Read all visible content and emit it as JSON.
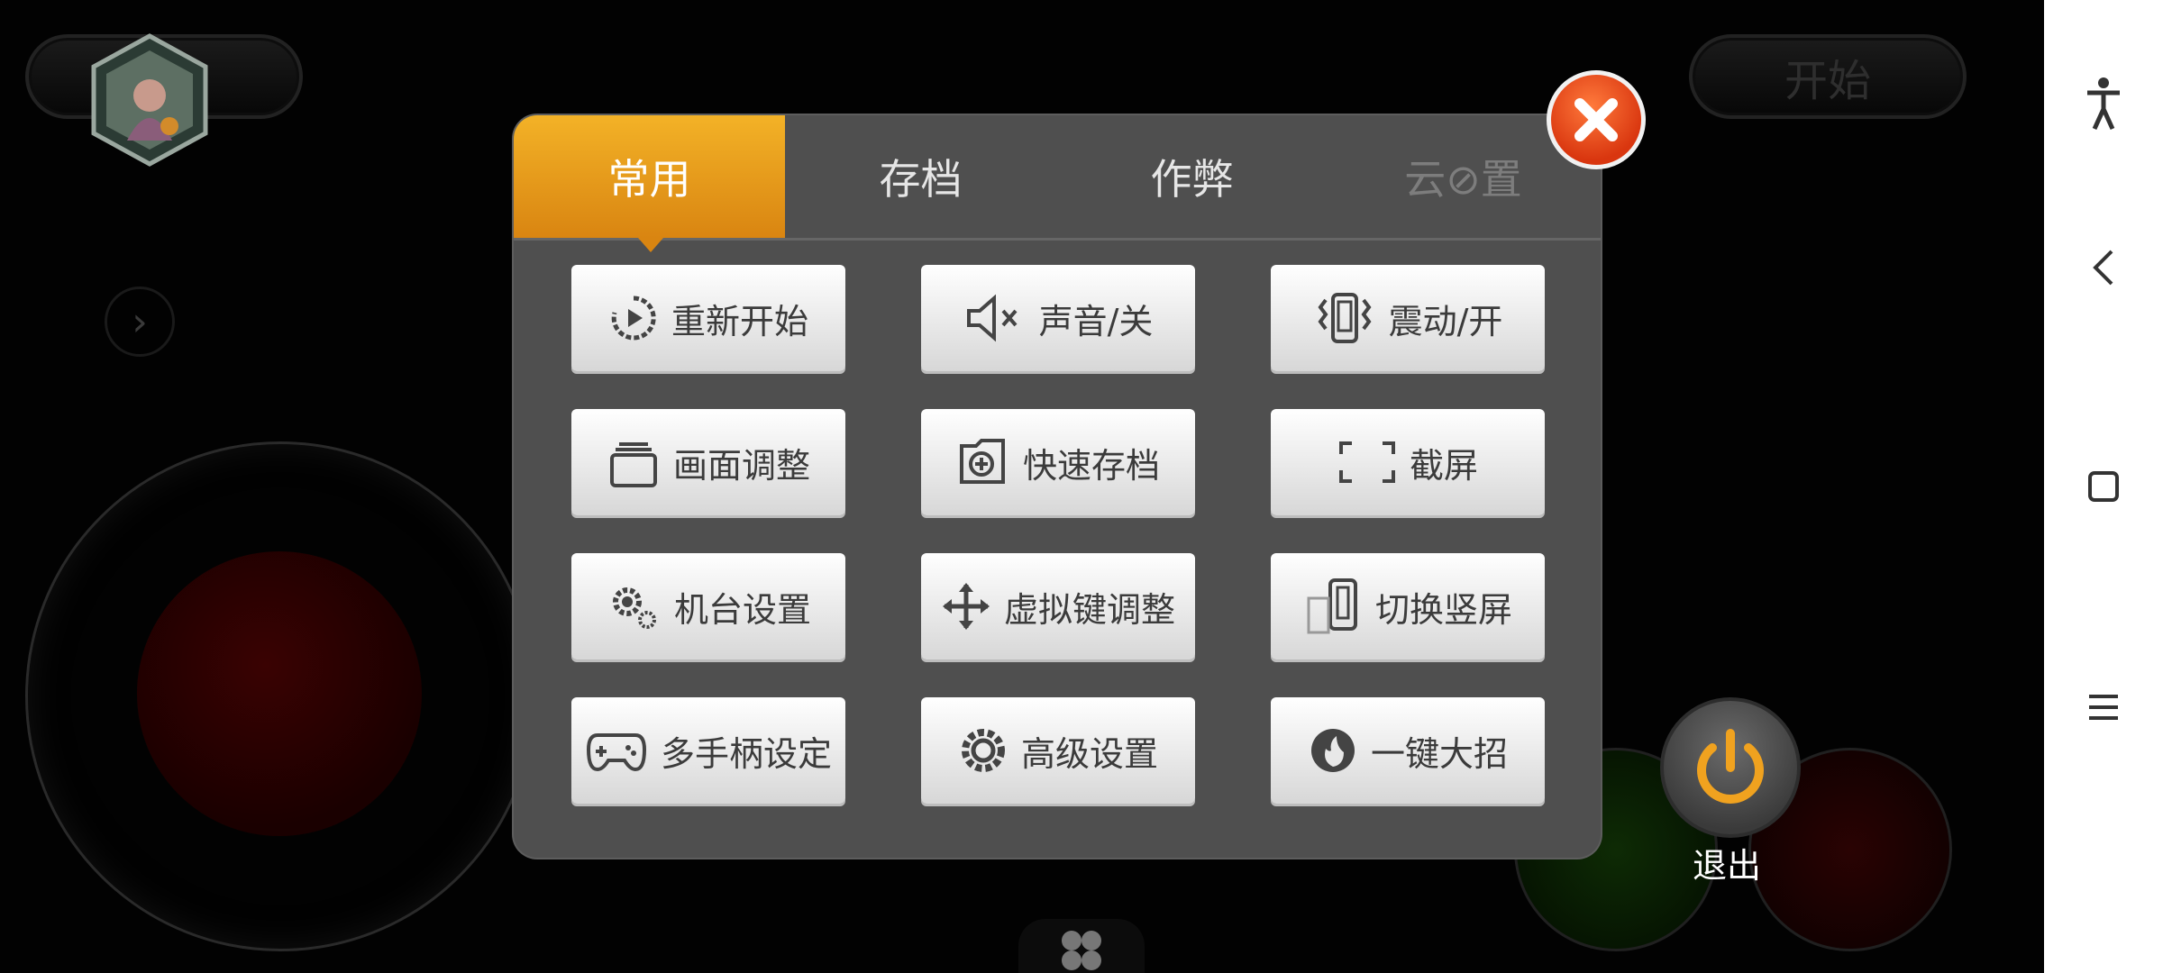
{
  "game": {
    "top_left_capsule": "",
    "start_button": "开始",
    "exit_label": "退出"
  },
  "dialog": {
    "tabs": [
      {
        "label": "常用",
        "state": "active"
      },
      {
        "label": "存档",
        "state": "normal"
      },
      {
        "label": "作弊",
        "state": "normal"
      },
      {
        "label": "云⊘置",
        "state": "disabled"
      }
    ],
    "items": [
      {
        "label": "重新开始",
        "icon": "restart-icon"
      },
      {
        "label": "声音/关",
        "icon": "mute-icon"
      },
      {
        "label": "震动/开",
        "icon": "vibrate-icon"
      },
      {
        "label": "画面调整",
        "icon": "layers-icon"
      },
      {
        "label": "快速存档",
        "icon": "save-icon"
      },
      {
        "label": "截屏",
        "icon": "screenshot-icon"
      },
      {
        "label": "机台设置",
        "icon": "gears-icon"
      },
      {
        "label": "虚拟键调整",
        "icon": "move-icon"
      },
      {
        "label": "切换竖屏",
        "icon": "rotate-icon"
      },
      {
        "label": "多手柄设定",
        "icon": "gamepad-icon"
      },
      {
        "label": "高级设置",
        "icon": "gear-icon"
      },
      {
        "label": "一键大招",
        "icon": "fire-icon"
      }
    ]
  },
  "colors": {
    "accent": "#f0a21f",
    "close": "#e2471a",
    "exit_icon": "#f0a21f"
  }
}
